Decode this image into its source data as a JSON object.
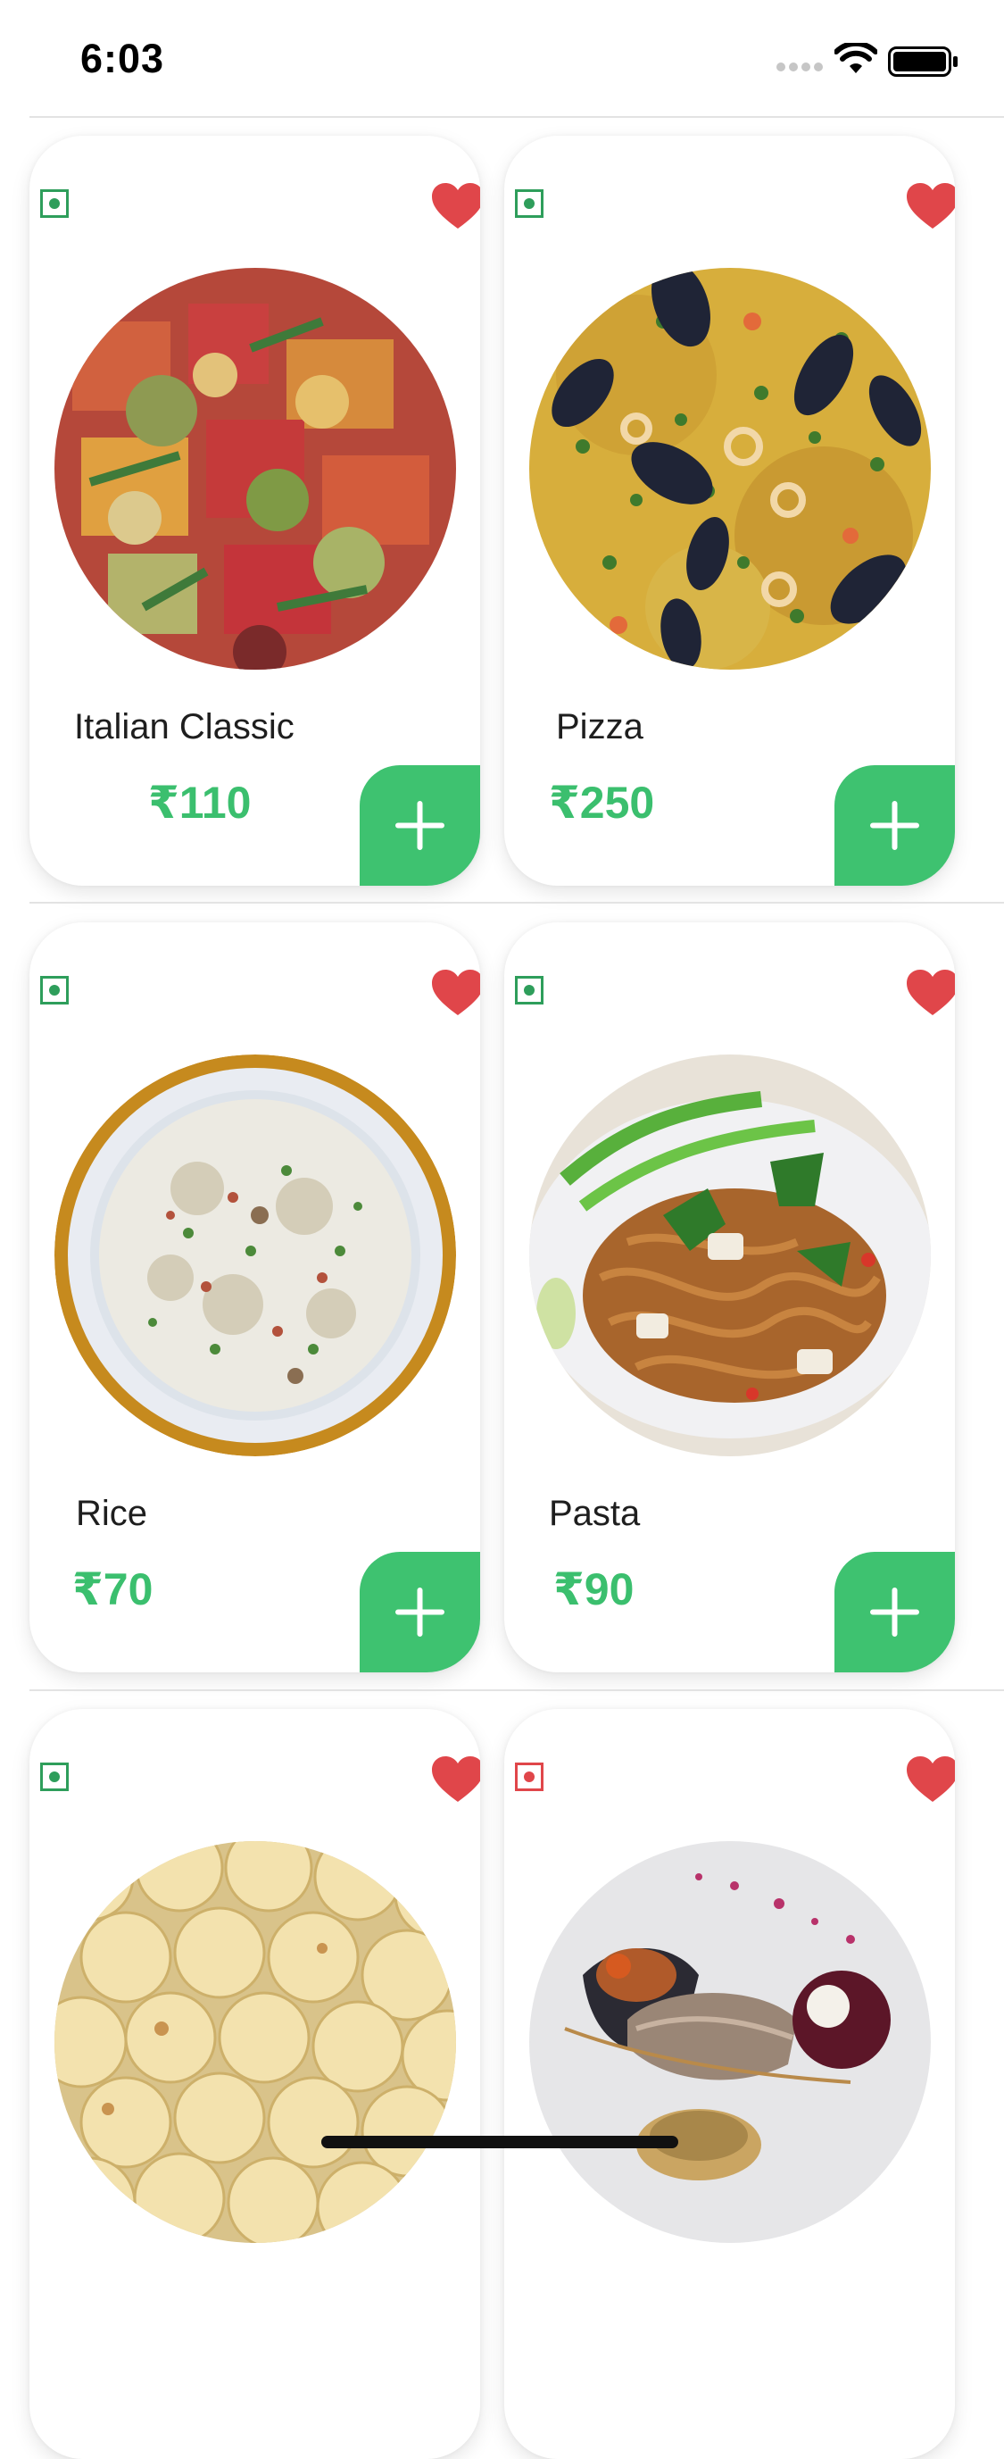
{
  "status_bar": {
    "time": "6:03"
  },
  "colors": {
    "accent_green": "#3bbf6e",
    "heart_red": "#e0464a",
    "veg_green": "#2e9e5b",
    "nonveg_red": "#e0464a"
  },
  "items": [
    {
      "name": "Italian Classic",
      "price": "₹110",
      "veg": true,
      "favorite": true,
      "image": "salad"
    },
    {
      "name": "Pizza",
      "price": "₹250",
      "veg": true,
      "favorite": true,
      "image": "paella"
    },
    {
      "name": "Rice",
      "price": "₹70",
      "veg": true,
      "favorite": true,
      "image": "rice-bowl"
    },
    {
      "name": "Pasta",
      "price": "₹90",
      "veg": true,
      "favorite": true,
      "image": "noodles"
    },
    {
      "name": "",
      "price": "",
      "veg": true,
      "favorite": true,
      "image": "sweets"
    },
    {
      "name": "",
      "price": "",
      "veg": false,
      "favorite": true,
      "image": "plated-dish"
    }
  ]
}
